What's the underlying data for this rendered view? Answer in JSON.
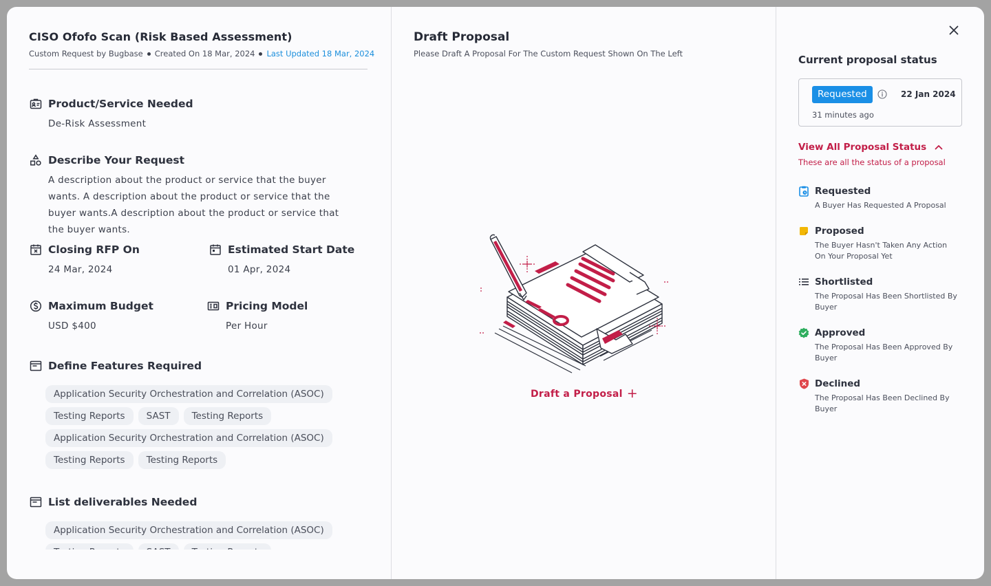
{
  "request": {
    "title": "CISO Ofofo Scan (Risk Based Assessment)",
    "requested_by": "Custom Request by Bugbase",
    "created_on": "Created On 18 Mar, 2024",
    "last_updated": "Last Updated 18 Mar, 2024"
  },
  "fields": {
    "product": {
      "label": "Product/Service Needed",
      "value": "De-Risk Assessment"
    },
    "describe": {
      "label": "Describe Your Request",
      "value": "A description about the product or service that the buyer wants. A description about the product or service that the buyer wants.A description about the product or service that the buyer wants."
    },
    "closing": {
      "label": "Closing RFP On",
      "value": "24 Mar, 2024"
    },
    "start": {
      "label": "Estimated Start Date",
      "value": "01 Apr, 2024"
    },
    "budget": {
      "label": "Maximum Budget",
      "value": "USD $400"
    },
    "pricing": {
      "label": "Pricing Model",
      "value": "Per Hour"
    }
  },
  "features": {
    "label": "Define Features Required",
    "chips": [
      "Application Security Orchestration and Correlation (ASOC)",
      "Testing Reports",
      "SAST",
      "Testing Reports",
      "Application Security Orchestration and Correlation (ASOC)",
      "Testing Reports",
      "Testing Reports"
    ]
  },
  "deliverables": {
    "label": "List deliverables Needed",
    "chips": [
      "Application Security Orchestration and Correlation (ASOC)",
      "Testing Reports",
      "SAST",
      "Testing Reports"
    ]
  },
  "draft": {
    "title": "Draft Proposal",
    "subtitle": "Please Draft A Proposal For The Custom Request Shown On The Left",
    "button": "Draft a Proposal",
    "button_icon": "+"
  },
  "status": {
    "title": "Current proposal status",
    "current": "Requested",
    "date": "22 Jan 2024",
    "ago": "31 minutes ago",
    "view_all": "View All Proposal Status",
    "view_all_sub": "These are all the status of a proposal",
    "items": [
      {
        "name": "Requested",
        "desc": "A Buyer Has Requested A Proposal",
        "icon": "clipboard-icon",
        "color": "#1a8fe6"
      },
      {
        "name": "Proposed",
        "desc": "The Buyer Hasn't Taken Any Action On Your Proposal Yet",
        "icon": "note-icon",
        "color": "#f2b705"
      },
      {
        "name": "Shortlisted",
        "desc": "The Proposal Has Been Shortlisted By Buyer",
        "icon": "list-icon",
        "color": "#2e323e"
      },
      {
        "name": "Approved",
        "desc": "The Proposal Has Been Approved By Buyer",
        "icon": "check-badge-icon",
        "color": "#2fae5f"
      },
      {
        "name": "Declined",
        "desc": "The Proposal Has Been Declined By Buyer",
        "icon": "x-shield-icon",
        "color": "#e0474c"
      }
    ]
  },
  "colors": {
    "accent": "#c21e48",
    "primary": "#1a8fe6"
  }
}
